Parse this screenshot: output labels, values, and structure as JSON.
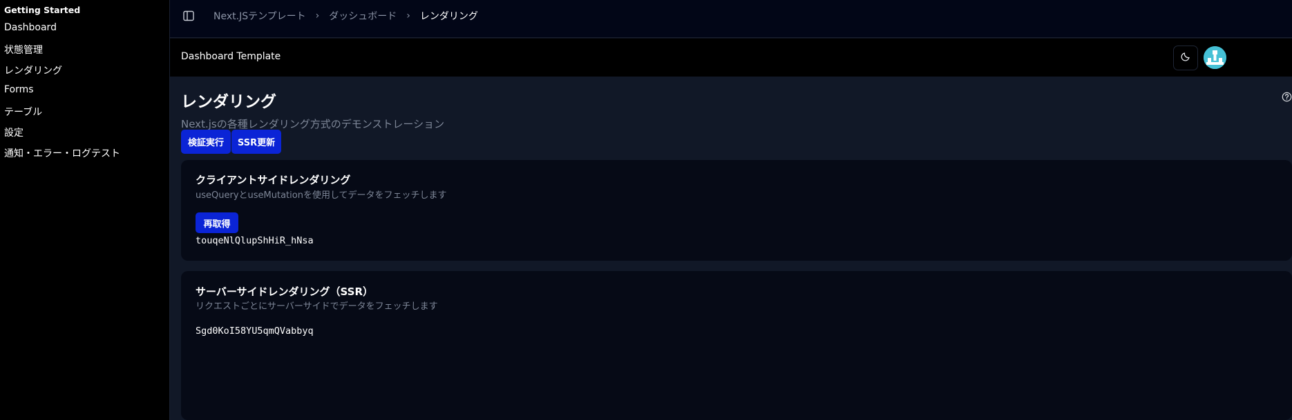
{
  "sidebar": {
    "group_title": "Getting Started",
    "items": [
      {
        "label": "Dashboard"
      },
      {
        "label": "状態管理"
      },
      {
        "label": "レンダリング"
      },
      {
        "label": "Forms"
      },
      {
        "label": "テーブル"
      },
      {
        "label": "設定"
      },
      {
        "label": "通知・エラー・ログテスト"
      }
    ]
  },
  "topbar": {
    "breadcrumb": [
      "Next.JSテンプレート",
      "ダッシュボード",
      "レンダリング"
    ],
    "separator": "›"
  },
  "header": {
    "app_title": "Dashboard Template"
  },
  "page": {
    "title": "レンダリング",
    "subtitle": "Next.jsの各種レンダリング方式のデモンストレーション",
    "buttons": {
      "verify": "検証実行",
      "ssr_refresh": "SSR更新"
    }
  },
  "cards": {
    "csr": {
      "title": "クライアントサイドレンダリング",
      "description": "useQueryとuseMutationを使用してデータをフェッチします",
      "refetch_label": "再取得",
      "value": "touqeNlQlupShHiR_hNsa"
    },
    "ssr": {
      "title": "サーバーサイドレンダリング（SSR）",
      "description": "リクエストごとにサーバーサイドでデータをフェッチします",
      "value": "Sgd0KoI58YU5qmQVabbyq"
    }
  },
  "colors": {
    "primary_button": "#0b24d6",
    "main_background": "#111827",
    "card_background": "#060a16",
    "sidebar_background": "#000000",
    "muted_text": "#7e8798"
  },
  "icons": {
    "sidebar_toggle": "sidebar-toggle-icon",
    "theme": "moon-icon",
    "help": "help-circle-icon"
  }
}
